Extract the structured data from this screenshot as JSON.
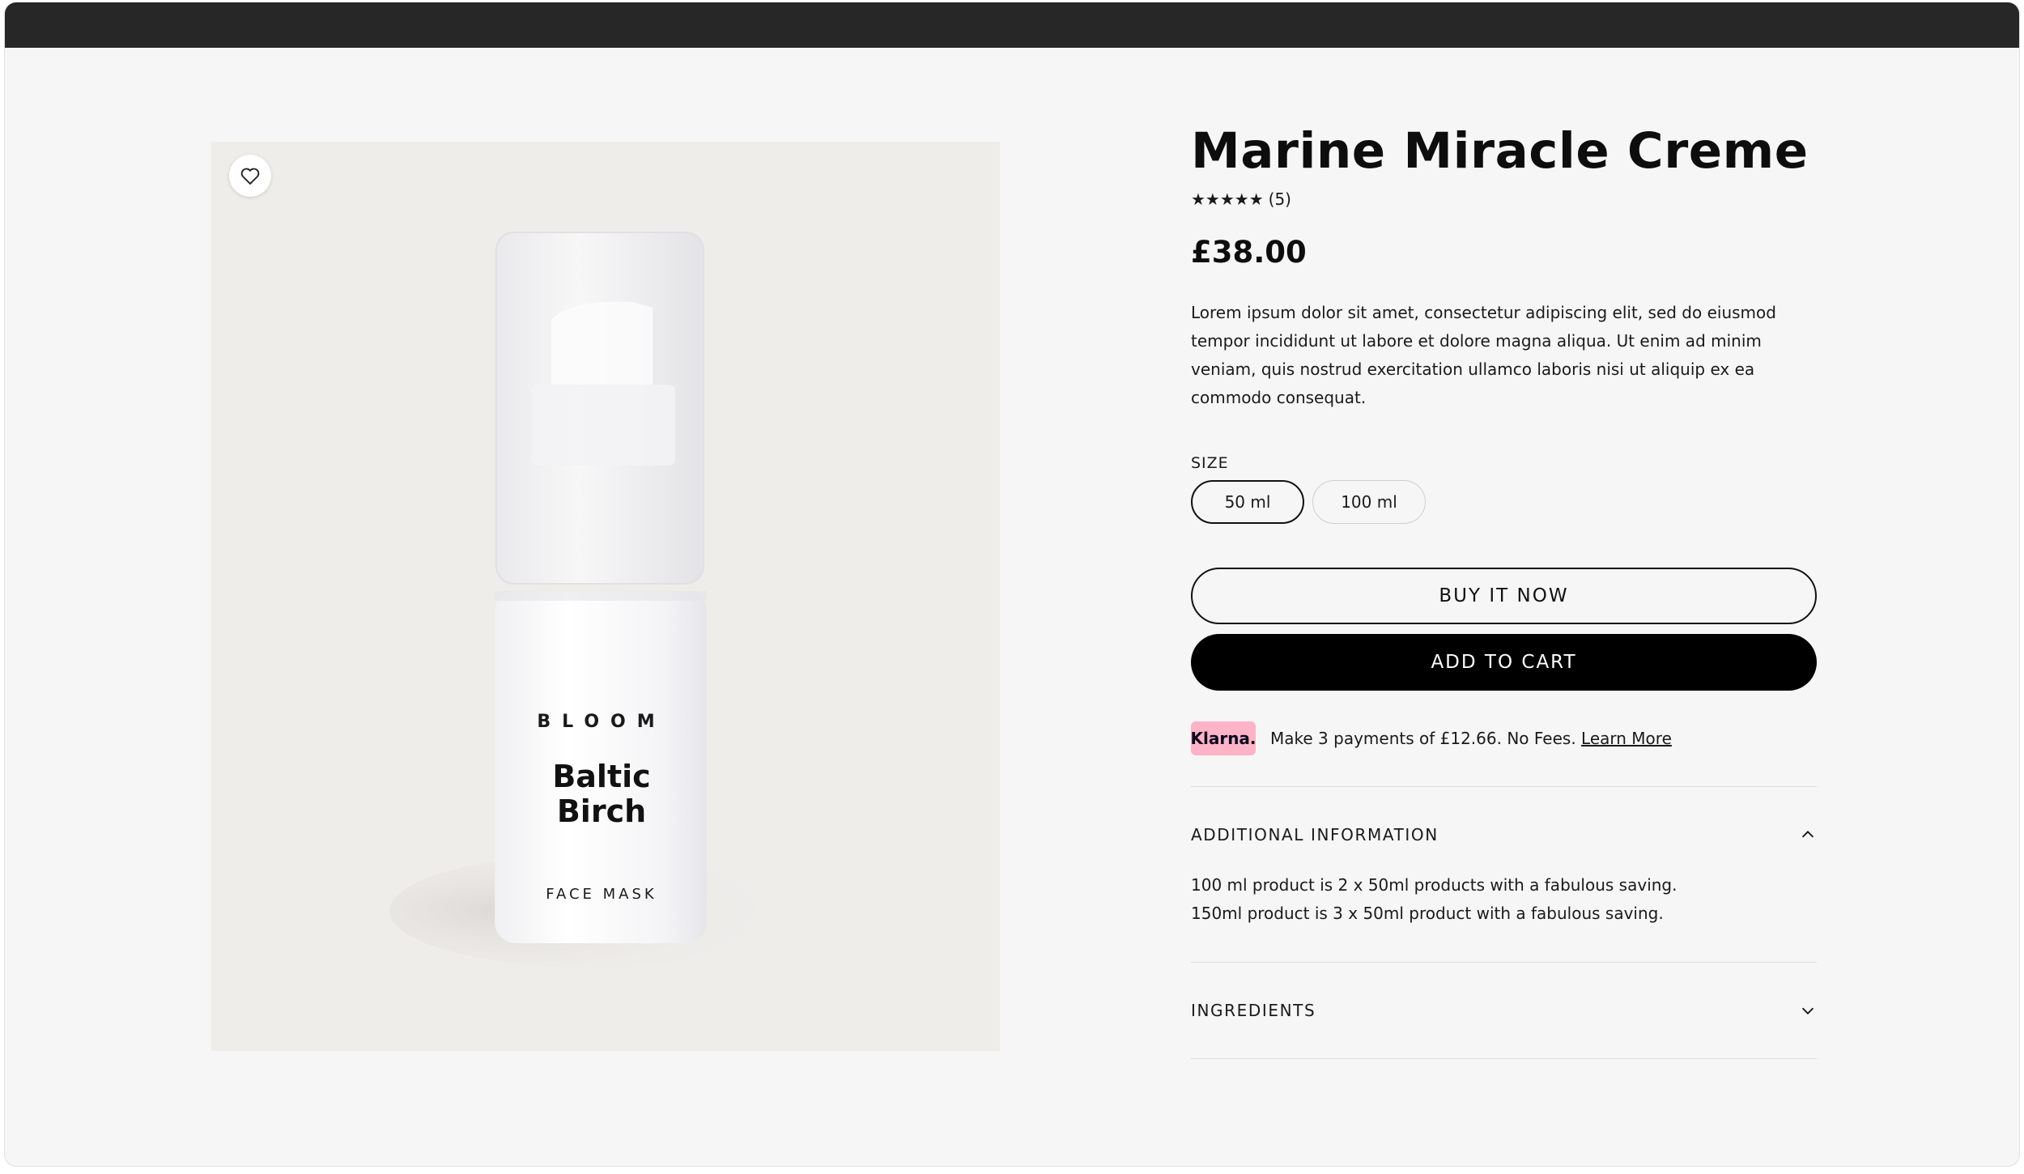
{
  "product": {
    "title": "Marine Miracle Creme",
    "stars": "★★★★★",
    "review_count": "(5)",
    "price": "£38.00",
    "description": "Lorem ipsum dolor sit amet, consectetur adipiscing elit, sed do eiusmod tempor incididunt ut labore et dolore magna aliqua. Ut enim ad minim veniam, quis nostrud exercitation ullamco laboris nisi ut aliquip ex ea commodo consequat."
  },
  "image": {
    "brand": "BLOOM",
    "name_line1": "Baltic",
    "name_line2": "Birch",
    "type": "FACE MASK",
    "wishlist_icon": "heart-icon"
  },
  "size": {
    "label": "SIZE",
    "options": [
      "50 ml",
      "100 ml"
    ],
    "selected": "50 ml"
  },
  "buttons": {
    "buy_now": "BUY IT NOW",
    "add_to_cart": "ADD TO CART"
  },
  "klarna": {
    "badge": "Klarna.",
    "text": "Make 3 payments of £12.66. No Fees.",
    "link": "Learn More",
    "badge_color": "#ffb3c7"
  },
  "accordions": {
    "additional": {
      "title": "ADDITIONAL INFORMATION",
      "expanded": true,
      "line1": "100 ml product is 2 x 50ml products with a fabulous saving.",
      "line2": "150ml product is 3 x 50ml product with a fabulous saving."
    },
    "ingredients": {
      "title": "INGREDIENTS",
      "expanded": false
    }
  },
  "colors": {
    "topbar": "#272727",
    "page_bg": "#f6f6f6",
    "image_bg": "#efedea",
    "primary_button": "#000000"
  }
}
